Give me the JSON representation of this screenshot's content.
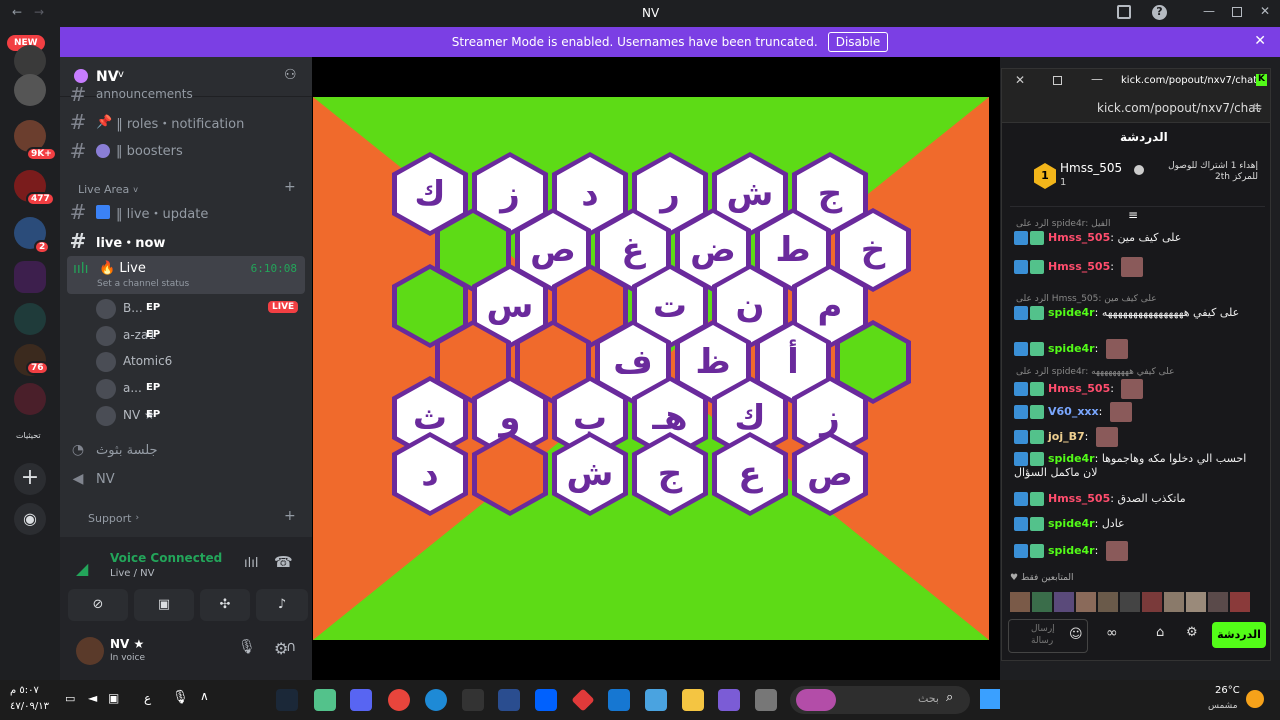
{
  "window": {
    "title": "NV",
    "search_ph": "بحث"
  },
  "banner": {
    "text": "Streamer Mode is enabled. Usernames have been truncated.",
    "disable": "Disable"
  },
  "guilds": {
    "new": "NEW",
    "b1": "9K+",
    "b2": "477",
    "b3": "2",
    "b4": "76",
    "label": "تحيثيات"
  },
  "server": {
    "name": "NV"
  },
  "channels": {
    "partial": "announcements",
    "roles": "‖ roles・notification",
    "boosters": "‖ boosters",
    "live_area": "Live Area",
    "live_update": "‖ live・update",
    "live_now": "live・now",
    "voice_live": "Live",
    "voice_timer": "6:10:08",
    "status_hint": "Set a channel status",
    "members": [
      {
        "name": "B...",
        "ep": "EP",
        "live": "LIVE"
      },
      {
        "name": "a-za1",
        "ep": "EP"
      },
      {
        "name": "Atomic6"
      },
      {
        "name": "a...",
        "ep": "EP"
      },
      {
        "name": "NV ★",
        "ep": "EP"
      }
    ],
    "session": "جلسة بثوث",
    "nv_voice": "NV",
    "support": "Support"
  },
  "voice_panel": {
    "status": "Voice Connected",
    "sub": "Live / NV"
  },
  "user": {
    "name": "NV ★",
    "status": "In voice"
  },
  "board": {
    "rows": [
      [
        "ك",
        "ز",
        "د",
        "ر",
        "ش",
        "ج"
      ],
      [
        "",
        "ص",
        "غ",
        "ض",
        "ط",
        "خ"
      ],
      [
        "",
        "س",
        "",
        "ت",
        "ن",
        "م"
      ],
      [
        "",
        "",
        "ف",
        "ظ",
        "أ",
        ""
      ],
      [
        "ث",
        "و",
        "ب",
        "هـ",
        "ك",
        "ز"
      ],
      [
        "د",
        "",
        "ش",
        "ج",
        "ع",
        "ص"
      ]
    ],
    "colors": [
      "w",
      "w",
      "w",
      "w",
      "w",
      "w",
      "g",
      "w",
      "w",
      "w",
      "w",
      "w",
      "g",
      "w",
      "o",
      "w",
      "w",
      "w",
      "o",
      "o",
      "w",
      "w",
      "w",
      "g",
      "w",
      "w",
      "w",
      "w",
      "w",
      "w",
      "w",
      "o",
      "w",
      "w",
      "w",
      "w"
    ]
  },
  "popout": {
    "title": "kick.com/popout/nxv7/chat...",
    "url": "kick.com/popout/nxv7/chat",
    "header": "الدردشة",
    "pinned_user": "Hmss_505",
    "pinned_count": "1",
    "pinned_text": "إهداء 1 اشتراك للوصول للمركز 2th",
    "messages": [
      {
        "reply": "الرد على spide4r: الفيل",
        "user": "Hmss_505",
        "text": "على كيف مين",
        "color": "#ff4d6d"
      },
      {
        "user": "Hmss_505",
        "text": "",
        "color": "#ff4d6d"
      },
      {
        "reply": "الرد على Hmss_505: على كيف مين",
        "user": "spide4r",
        "text": "على كيفي ههههههههههههههههه",
        "color": "#53fc18"
      },
      {
        "user": "spide4r",
        "text": "",
        "color": "#53fc18"
      },
      {
        "reply": "الرد على spide4r: على كيفي هههههههههه",
        "user": "Hmss_505",
        "text": "",
        "color": "#ff4d6d"
      },
      {
        "user": "V60_xxx",
        "text": "",
        "color": "#7aa7ff"
      },
      {
        "user": "joj_B7",
        "text": "",
        "color": "#f0d090"
      },
      {
        "user": "spide4r",
        "text": "احسب الي دخلوا مكه وهاجموها لان ماكمل السؤال",
        "color": "#53fc18"
      },
      {
        "user": "Hmss_505",
        "text": "ماتكذب الصدق",
        "color": "#ff4d6d"
      },
      {
        "user": "spide4r",
        "text": "عادل",
        "color": "#53fc18"
      },
      {
        "user": "spide4r",
        "text": "",
        "color": "#53fc18"
      }
    ],
    "emotes_label": "المتابعين فقط",
    "send": "الدردشة",
    "input_ph": "إرسال رسالة"
  },
  "taskbar": {
    "time": "٥:٠٧ م",
    "date": "٤٧/٠٩/١٣",
    "weather": "26°C",
    "weather_sub": "مشمس",
    "lang": "ع"
  }
}
